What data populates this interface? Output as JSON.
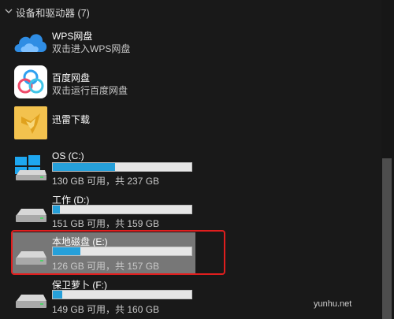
{
  "group": {
    "title": "设备和驱动器 (7)"
  },
  "items": [
    {
      "name": "WPS网盘",
      "subtitle": "双击进入WPS网盘"
    },
    {
      "name": "百度网盘",
      "subtitle": "双击运行百度网盘"
    },
    {
      "name": "迅雷下载"
    }
  ],
  "drives": [
    {
      "name": "OS (C:)",
      "info": "130 GB 可用，共 237 GB",
      "used_fraction": 0.45
    },
    {
      "name": "工作 (D:)",
      "info": "151 GB 可用，共 159 GB",
      "used_fraction": 0.05
    },
    {
      "name": "本地磁盘 (E:)",
      "info": "126 GB 可用，共 157 GB",
      "used_fraction": 0.2
    },
    {
      "name": "保卫萝卜 (F:)",
      "info": "149 GB 可用，共 160 GB",
      "used_fraction": 0.07
    }
  ],
  "colors": {
    "accent": "#26a0da",
    "selection": "#777777",
    "highlight_border": "#e01e1e"
  },
  "watermark": "yunhu.net"
}
